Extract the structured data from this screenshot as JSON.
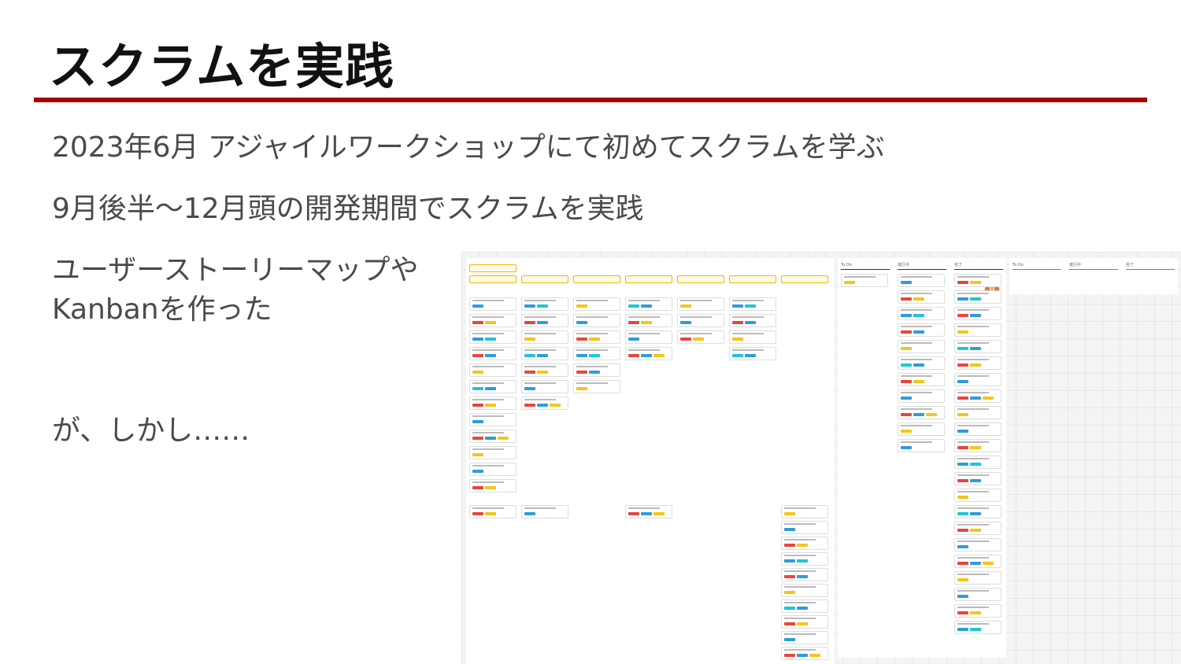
{
  "slide": {
    "title": "スクラムを実践",
    "bullets": [
      "2023年6月 アジャイルワークショップにて初めてスクラムを学ぶ",
      "9月後半〜12月頭の開発期間でスクラムを実践",
      "ユーザーストーリーマップや",
      "Kanbanを作った",
      "が、しかし……"
    ],
    "accent_color": "#a80000"
  },
  "board": {
    "avatar_initial": "M",
    "kanban_headers": [
      "To Do",
      "進行中",
      "完了"
    ],
    "kanban2_headers": [
      "To Do",
      "進行中",
      "完了"
    ],
    "tag_colors": {
      "red": "#e8463a",
      "yellow": "#f5c518",
      "blue": "#2d9cdb",
      "cyan": "#1cc6d6"
    }
  }
}
